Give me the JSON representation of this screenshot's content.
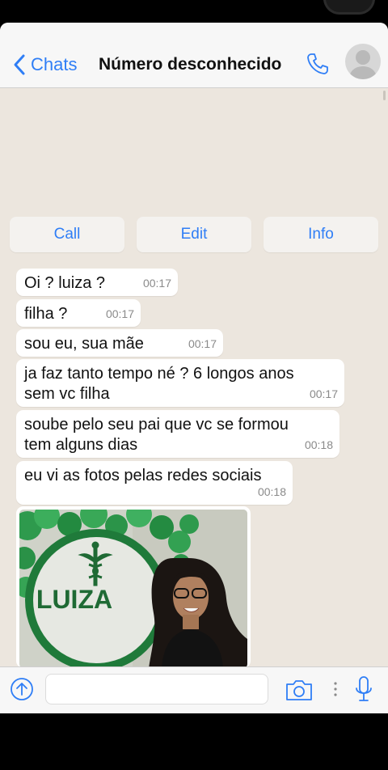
{
  "header": {
    "back_label": "Chats",
    "title": "Número desconhecido"
  },
  "actions": {
    "call": "Call",
    "edit": "Edit",
    "info": "Info"
  },
  "messages": [
    {
      "text": "Oi ? luiza ?",
      "time": "00:17"
    },
    {
      "text": "filha ?",
      "time": "00:17"
    },
    {
      "text": "sou eu, sua mãe",
      "time": "00:17"
    },
    {
      "text": "ja faz tanto tempo né ? 6 longos anos\nsem vc filha",
      "time": "00:17"
    },
    {
      "text": "soube pelo seu pai que vc se formou\ntem alguns dias",
      "time": "00:18"
    },
    {
      "text": "eu vi as fotos pelas redes sociais",
      "time": "00:18"
    }
  ],
  "photo": {
    "banner_text": "LUIZA"
  },
  "composer": {
    "value": "",
    "placeholder": ""
  },
  "colors": {
    "accent": "#2f7ef6",
    "chat_bg": "#ece6de",
    "bubble": "#ffffff",
    "banner_green": "#1f7a3a"
  },
  "icons": [
    "chevron-left-icon",
    "phone-icon",
    "avatar-icon",
    "upload-arrow-icon",
    "camera-icon",
    "more-dots-icon",
    "microphone-icon"
  ]
}
